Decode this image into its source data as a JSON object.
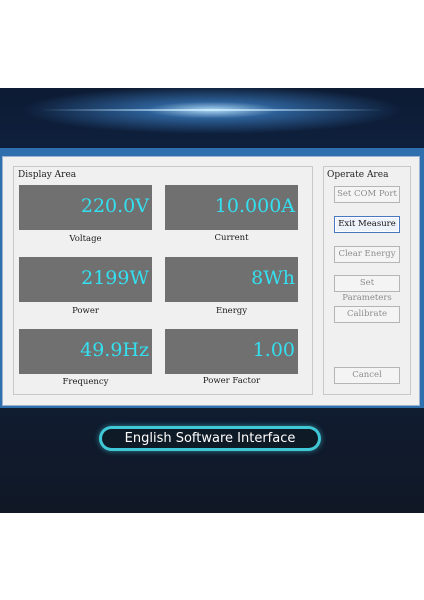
{
  "display_area": {
    "title": "Display Area",
    "readings": [
      {
        "value": "220.0V",
        "label": "Voltage"
      },
      {
        "value": "10.000A",
        "label": "Current"
      },
      {
        "value": "2199W",
        "label": "Power"
      },
      {
        "value": "8Wh",
        "label": "Energy"
      },
      {
        "value": "49.9Hz",
        "label": "Frequency"
      },
      {
        "value": "1.00",
        "label": "Power Factor"
      }
    ]
  },
  "operate_area": {
    "title": "Operate Area",
    "buttons": [
      {
        "label": "Set COM Port",
        "enabled": false
      },
      {
        "label": "Exit Measure",
        "enabled": true
      },
      {
        "label": "Clear Energy",
        "enabled": false
      },
      {
        "label": "Set Parameters",
        "enabled": false
      },
      {
        "label": "Calibrate",
        "enabled": false
      },
      {
        "label": "Cancel",
        "enabled": false
      }
    ]
  },
  "banner": {
    "caption": "English Software Interface"
  },
  "colors": {
    "display_bg": "#707070",
    "display_text": "#34e0f0",
    "accent_pill": "#40c8d6",
    "window_frame": "#2f6fae"
  }
}
